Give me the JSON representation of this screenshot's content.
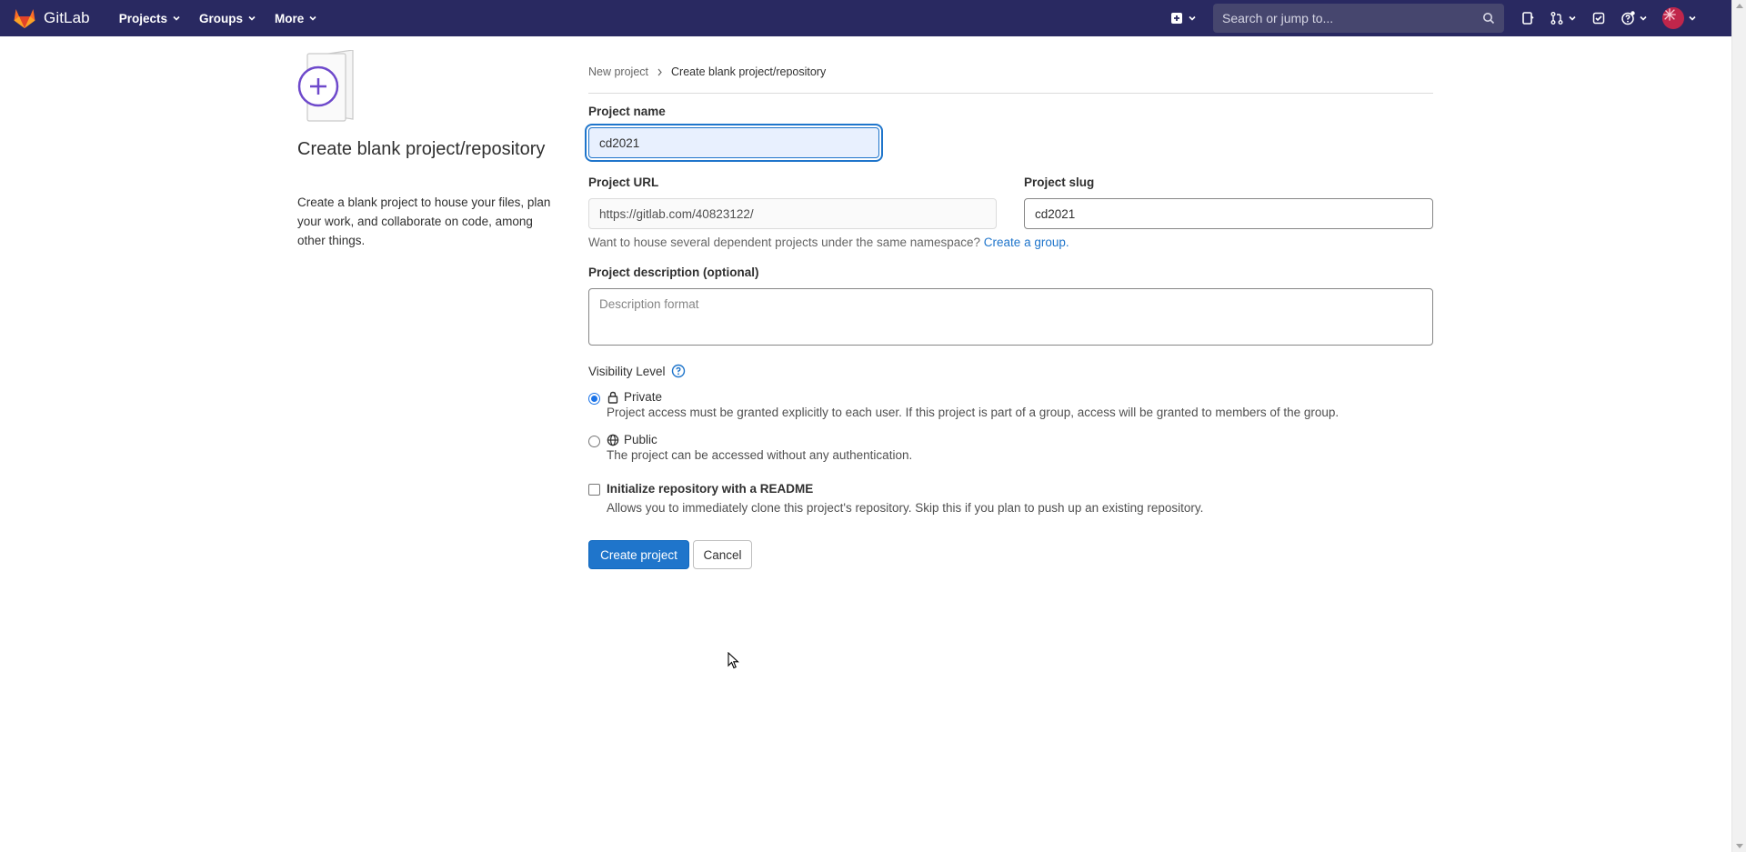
{
  "navbar": {
    "brand": "GitLab",
    "menu": [
      {
        "label": "Projects"
      },
      {
        "label": "Groups"
      },
      {
        "label": "More"
      }
    ],
    "search": {
      "placeholder": "Search or jump to..."
    },
    "icons": [
      "plus-square-icon",
      "search-icon",
      "issues-icon",
      "merge-request-icon",
      "todo-icon",
      "help-icon",
      "avatar"
    ],
    "colors": {
      "bar": "#292961",
      "search_bg": "#46466e"
    }
  },
  "left_panel": {
    "title": "Create blank project/repository",
    "description": "Create a blank project to house your files, plan your work, and collaborate on code, among other things."
  },
  "breadcrumb": {
    "items": [
      {
        "label": "New project"
      },
      {
        "label": "Create blank project/repository"
      }
    ]
  },
  "form": {
    "project_name": {
      "label": "Project name",
      "value": "cd2021"
    },
    "project_url": {
      "label": "Project URL",
      "value": "https://gitlab.com/40823122/"
    },
    "project_slug": {
      "label": "Project slug",
      "value": "cd2021"
    },
    "namespace_help": {
      "text": "Want to house several dependent projects under the same namespace?",
      "link": "Create a group."
    },
    "description": {
      "label": "Project description (optional)",
      "placeholder": "Description format"
    },
    "visibility": {
      "label": "Visibility Level",
      "options": [
        {
          "label": "Private",
          "description": "Project access must be granted explicitly to each user. If this project is part of a group, access will be granted to members of the group.",
          "checked": true,
          "icon": "lock-icon"
        },
        {
          "label": "Public",
          "description": "The project can be accessed without any authentication.",
          "checked": false,
          "icon": "globe-icon"
        }
      ]
    },
    "readme": {
      "label": "Initialize repository with a README",
      "description": "Allows you to immediately clone this project's repository. Skip this if you plan to push up an existing repository.",
      "checked": false
    },
    "actions": {
      "create": "Create project",
      "cancel": "Cancel"
    },
    "colors": {
      "primary": "#1f75cb",
      "focus": "#1f75cb"
    }
  }
}
